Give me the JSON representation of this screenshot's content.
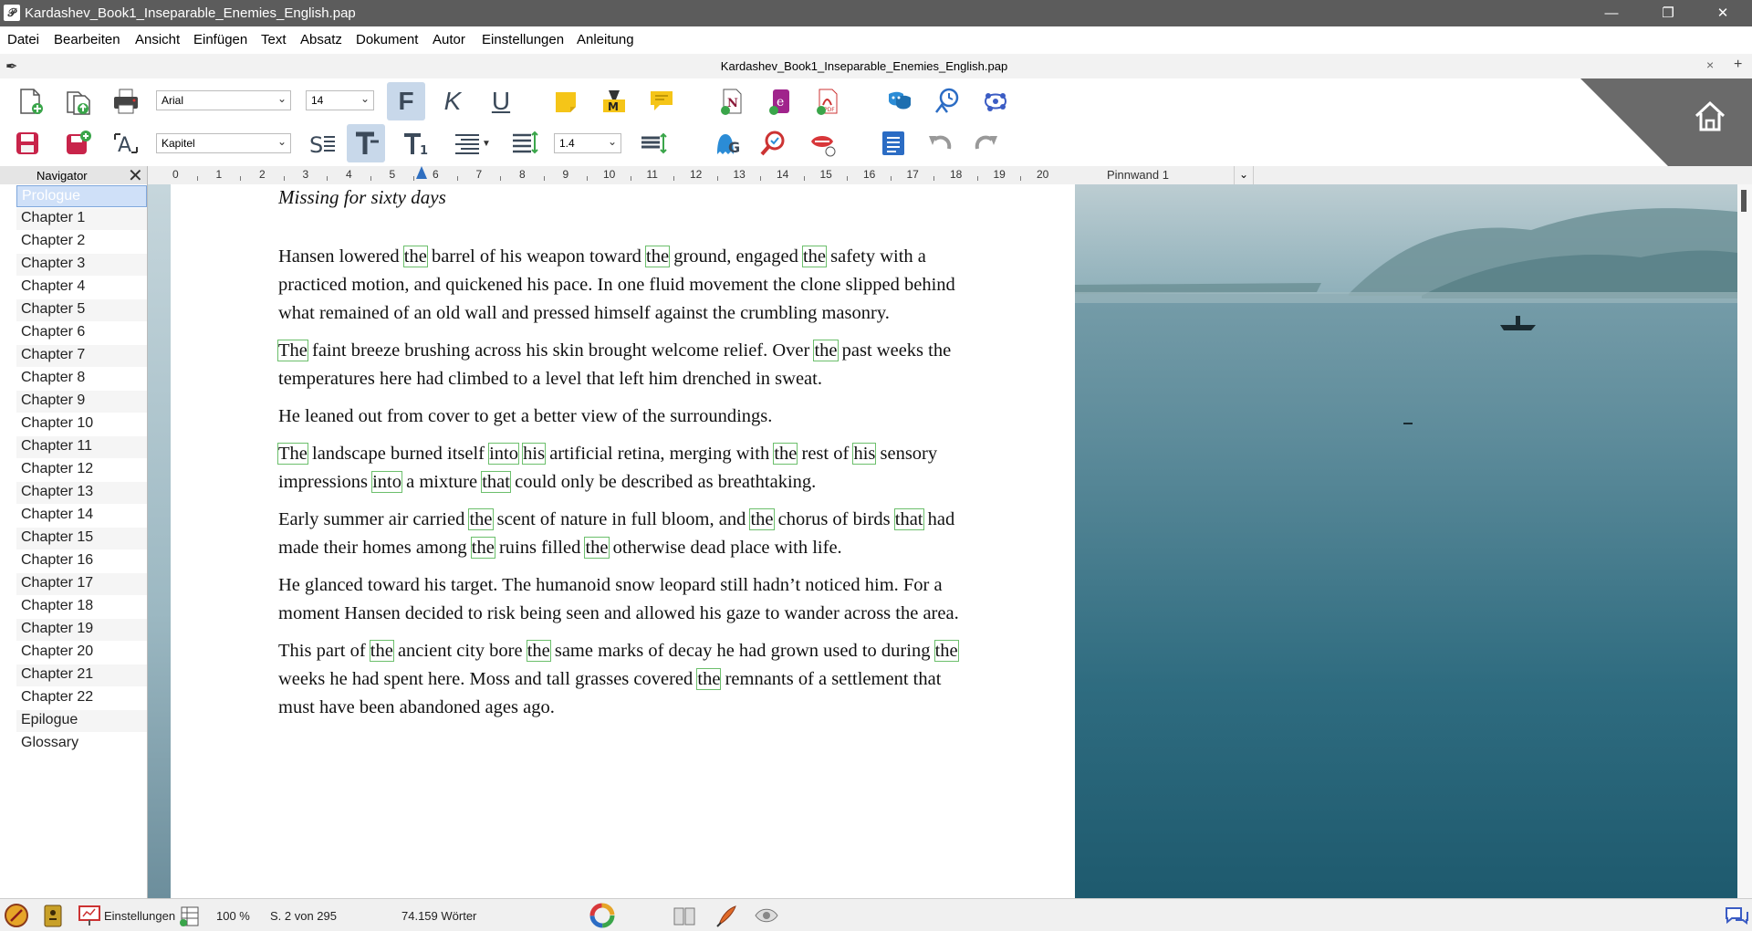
{
  "window": {
    "title": "Kardashev_Book1_Inseparable_Enemies_English.pap",
    "app_icon": "papyrus-app-icon",
    "minimize": "—",
    "restore": "❐",
    "close": "✕"
  },
  "menu": [
    "Datei",
    "Bearbeiten",
    "Ansicht",
    "Einfügen",
    "Text",
    "Absatz",
    "Dokument",
    "Autor",
    "Einstellungen",
    "Anleitung"
  ],
  "document_tab": {
    "title": "Kardashev_Book1_Inseparable_Enemies_English.pap",
    "close": "×",
    "add": "+"
  },
  "toolbar": {
    "font": "Arial",
    "font_size": "14",
    "style": "Kapitel",
    "line_spacing": "1.4",
    "bold": "F",
    "italic": "K",
    "underline": "U"
  },
  "ruler": {
    "numbers": [
      "0",
      "1",
      "2",
      "3",
      "4",
      "5",
      "6",
      "7",
      "8",
      "9",
      "10",
      "11",
      "12",
      "13",
      "14",
      "15",
      "16",
      "17",
      "18",
      "19",
      "20"
    ]
  },
  "navigator": {
    "title": "Navigator",
    "close": "✕",
    "items": [
      "Prologue",
      "Chapter 1",
      "Chapter 2",
      "Chapter 3",
      "Chapter 4",
      "Chapter 5",
      "Chapter 6",
      "Chapter 7",
      "Chapter 8",
      "Chapter 9",
      "Chapter 10",
      "Chapter 11",
      "Chapter 12",
      "Chapter 13",
      "Chapter 14",
      "Chapter 15",
      "Chapter 16",
      "Chapter 17",
      "Chapter 18",
      "Chapter 19",
      "Chapter 20",
      "Chapter 21",
      "Chapter 22",
      "Epilogue",
      "Glossary"
    ],
    "selected_index": 0
  },
  "pinnwand": {
    "label": "Pinnwand 1",
    "dropdown": "⌄"
  },
  "document": {
    "heading": "Missing for sixty days",
    "highlight_color": "#6cbf6c"
  },
  "status": {
    "settings": "Einstellungen",
    "zoom": "100 %",
    "page": "S. 2 von 295",
    "words": "74.159 Wörter"
  }
}
